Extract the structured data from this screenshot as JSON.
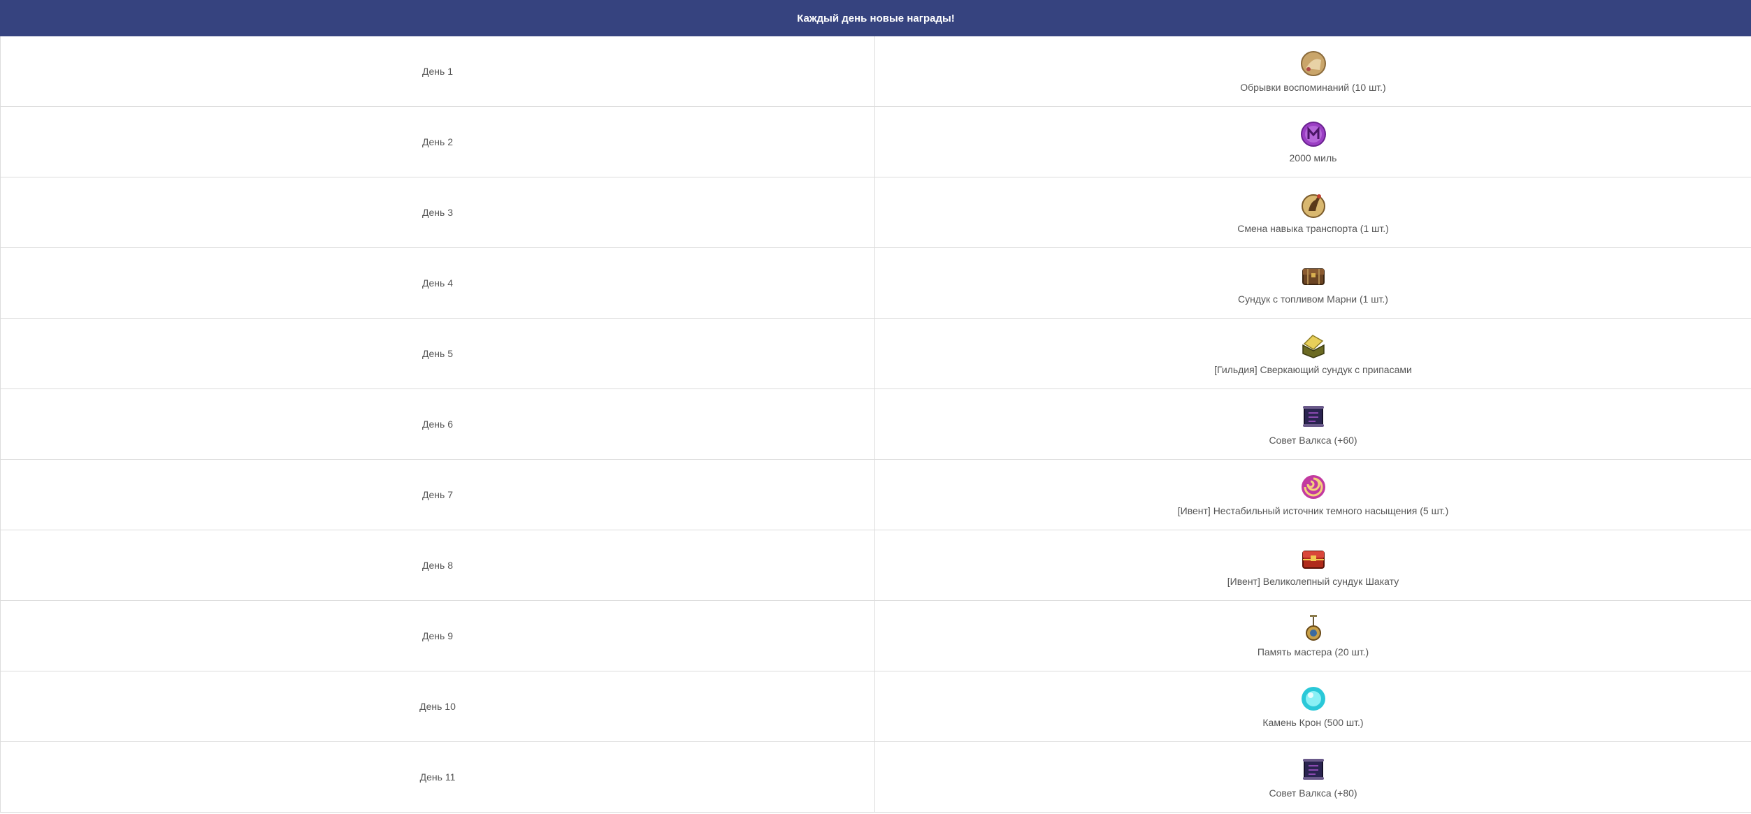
{
  "table": {
    "header": "Каждый день новые награды!",
    "rows": [
      {
        "day": "День 1",
        "reward": "Обрывки воспоминаний (10 шт.)",
        "icon": "memory-scraps-icon"
      },
      {
        "day": "День 2",
        "reward": "2000 миль",
        "icon": "miles-coin-icon"
      },
      {
        "day": "День 3",
        "reward": "Смена навыка транспорта (1 шт.)",
        "icon": "mount-skill-change-icon"
      },
      {
        "day": "День 4",
        "reward": "Сундук с топливом Марни (1 шт.)",
        "icon": "fuel-chest-icon"
      },
      {
        "day": "День 5",
        "reward": "[Гильдия] Сверкающий сундук с припасами",
        "icon": "guild-supply-chest-icon"
      },
      {
        "day": "День 6",
        "reward": "Совет Валкса (+60)",
        "icon": "valks-scroll-icon"
      },
      {
        "day": "День 7",
        "reward": "[Ивент] Нестабильный источник темного насыщения (5 шт.)",
        "icon": "dark-vortex-icon"
      },
      {
        "day": "День 8",
        "reward": "[Ивент] Великолепный сундук Шакату",
        "icon": "shakatu-chest-icon"
      },
      {
        "day": "День 9",
        "reward": "Память мастера (20 шт.)",
        "icon": "master-memory-pendant-icon"
      },
      {
        "day": "День 10",
        "reward": "Камень Крон (500 шт.)",
        "icon": "cron-stone-icon"
      },
      {
        "day": "День 11",
        "reward": "Совет Валкса (+80)",
        "icon": "valks-scroll-icon"
      }
    ]
  },
  "colors": {
    "header_bg": "#36437f",
    "header_text": "#ffffff",
    "cell_text": "#555555",
    "border": "#dcdcdc"
  }
}
